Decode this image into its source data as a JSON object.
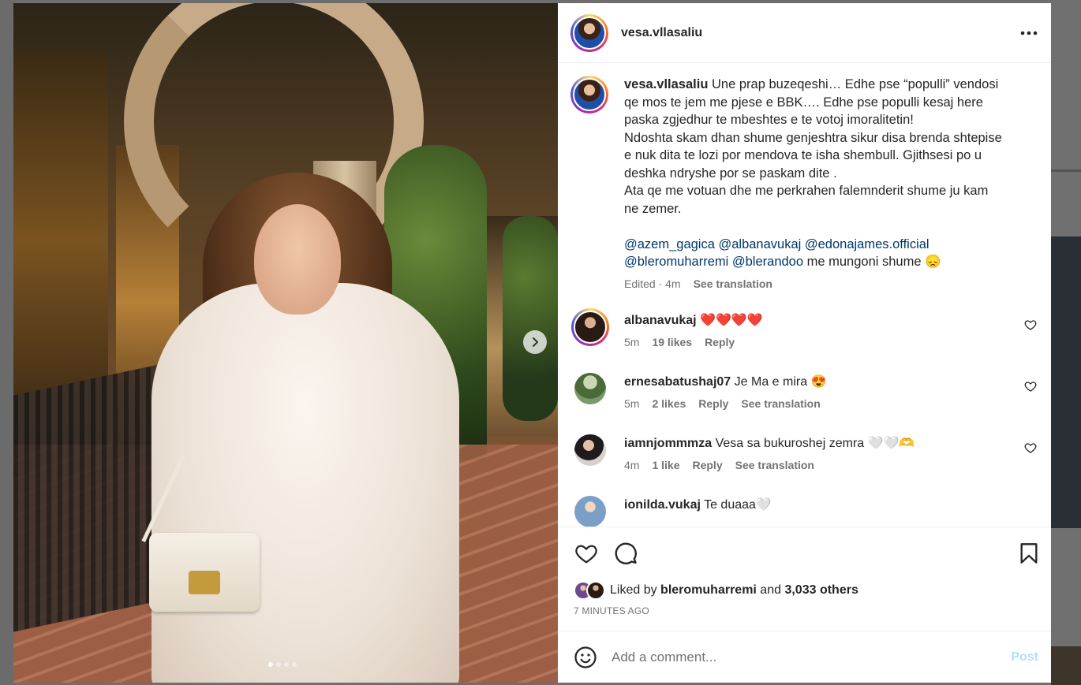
{
  "post": {
    "username": "vesa.vllasaliu",
    "caption_lines": [
      "Une prap buzeqeshi… Edhe pse “populli” vendosi",
      "qe mos te jem me pjese e BBK…. Edhe pse populli kesaj here",
      "paska zgjedhur te mbeshtes e te votoj imoralitetin!",
      "Ndoshta skam dhan shume genjeshtra sikur disa brenda shtepise",
      "e nuk dita te lozi por mendova te isha shembull. Gjithsesi po u",
      "deshka ndryshe por se paskam dite .",
      "Ata qe me votuan dhe me perkrahen falemnderit shume ju kam",
      "ne zemer."
    ],
    "mentions_line1": "@azem_gagica @albanavukaj @edonajames.official",
    "mentions_line2": "@bleromuharremi @blerandoo",
    "mentions_tail": " me mungoni shume 😞",
    "edited": "Edited · 4m",
    "see_translation": "See translation",
    "photo_index": 1,
    "photo_count": 4
  },
  "comments": [
    {
      "username": "albanavukaj",
      "text": "❤️❤️❤️❤️",
      "time": "5m",
      "likes": "19 likes",
      "reply": "Reply",
      "translation": "",
      "avatar_color": "#3a2a2a",
      "story_ring": true
    },
    {
      "username": "ernesabatushaj07",
      "text": "Je Ma e mira 😍",
      "time": "5m",
      "likes": "2 likes",
      "reply": "Reply",
      "translation": "See translation",
      "avatar_color": "#6a8a5a",
      "story_ring": false
    },
    {
      "username": "iamnjommmza",
      "text": "Vesa sa bukuroshej zemra 🤍🤍🫶",
      "time": "4m",
      "likes": "1 like",
      "reply": "Reply",
      "translation": "See translation",
      "avatar_color": "#2e2a2e",
      "story_ring": false
    },
    {
      "username": "ionilda.vukaj",
      "text": "Te duaaa🤍",
      "time": "",
      "likes": "",
      "reply": "",
      "translation": "",
      "avatar_color": "#7aa0c8",
      "story_ring": false
    }
  ],
  "likes_bar": {
    "prefix": "Liked by ",
    "user": "bleromuharremi",
    "middle": " and ",
    "others": "3,033 others",
    "time_ago": "7 MINUTES AGO"
  },
  "composer": {
    "placeholder": "Add a comment...",
    "post_label": "Post"
  },
  "icons": [
    "more-options-icon",
    "heart-icon",
    "comment-icon",
    "bookmark-icon",
    "emoji-icon",
    "chevron-right-icon"
  ],
  "colors": {
    "mention": "#00376b",
    "muted": "#737373",
    "post_disabled": "#b2dffc",
    "like_red": "#ed4956"
  }
}
